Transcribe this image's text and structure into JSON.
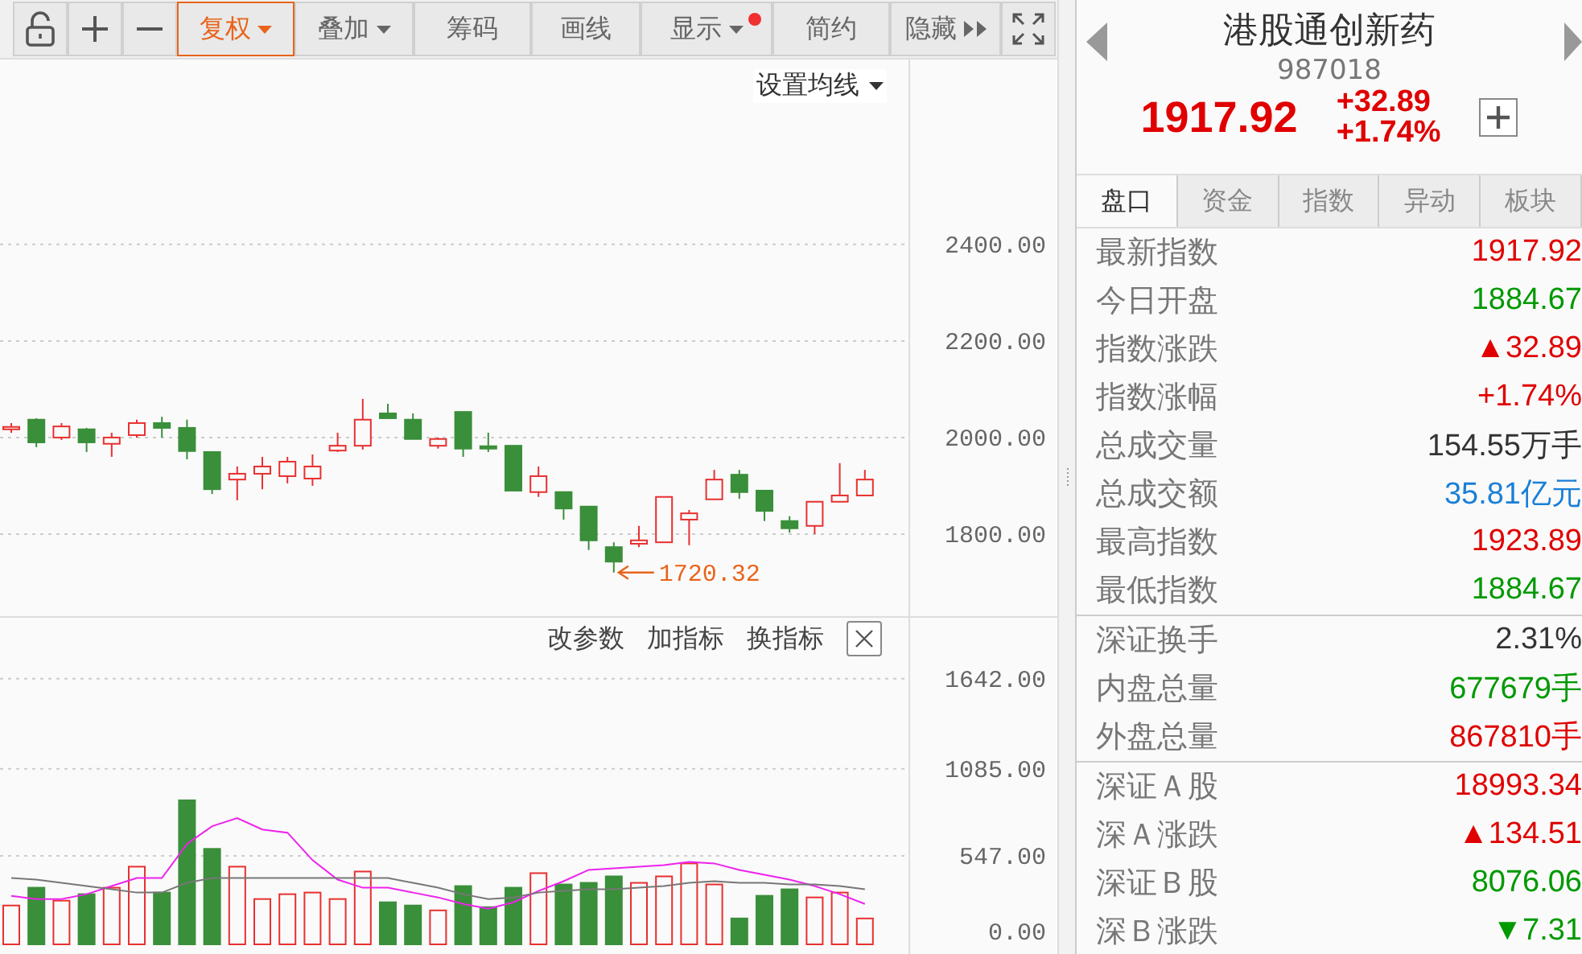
{
  "toolbar": [
    {
      "kind": "lock",
      "selected": false
    },
    {
      "kind": "plus",
      "selected": false
    },
    {
      "kind": "minus",
      "selected": false
    },
    {
      "kind": "text",
      "label": "复权",
      "selected": true,
      "dropdown": true,
      "chevrons": false,
      "alert": false
    },
    {
      "kind": "text",
      "label": "叠加",
      "selected": false,
      "dropdown": true,
      "chevrons": false,
      "alert": false
    },
    {
      "kind": "text",
      "label": "筹码",
      "selected": false,
      "dropdown": false,
      "chevrons": false,
      "alert": false
    },
    {
      "kind": "text",
      "label": "画线",
      "selected": false,
      "dropdown": false,
      "chevrons": false,
      "alert": false
    },
    {
      "kind": "text",
      "label": "显示",
      "selected": false,
      "dropdown": true,
      "chevrons": false,
      "alert": true
    },
    {
      "kind": "text",
      "label": "简约",
      "selected": false,
      "dropdown": false,
      "chevrons": false,
      "alert": false
    },
    {
      "kind": "text",
      "label": "隐藏",
      "selected": false,
      "dropdown": false,
      "chevrons": true,
      "alert": false
    },
    {
      "kind": "fullscreen",
      "selected": false
    }
  ],
  "price_chart": {
    "ma_setting": "设置均线",
    "chart_data": {
      "type": "candlestick",
      "ylim": [
        1630,
        2783
      ],
      "yticks": [
        {
          "value": 2400,
          "label": "2400.00"
        },
        {
          "value": 2200,
          "label": "2200.00"
        },
        {
          "value": 2000,
          "label": "2000.00"
        },
        {
          "value": 1800,
          "label": "1800.00"
        }
      ],
      "ohlc": [
        [
          2018,
          2030,
          2010,
          2022
        ],
        [
          2037,
          2040,
          1980,
          1990
        ],
        [
          2000,
          2030,
          1995,
          2023
        ],
        [
          2017,
          2020,
          1970,
          1990
        ],
        [
          1987,
          2010,
          1960,
          2000
        ],
        [
          2005,
          2037,
          2000,
          2030
        ],
        [
          2030,
          2043,
          2000,
          2020
        ],
        [
          2020,
          2037,
          1955,
          1972
        ],
        [
          1970,
          1970,
          1883,
          1893
        ],
        [
          1913,
          1940,
          1870,
          1925
        ],
        [
          1925,
          1960,
          1893,
          1940
        ],
        [
          1920,
          1960,
          1905,
          1950
        ],
        [
          1915,
          1965,
          1900,
          1940
        ],
        [
          1973,
          2010,
          1970,
          1983
        ],
        [
          1983,
          2080,
          1975,
          2037
        ],
        [
          2050,
          2070,
          2040,
          2040
        ],
        [
          2037,
          2050,
          1997,
          1997
        ],
        [
          1983,
          2000,
          1977,
          1997
        ],
        [
          2053,
          2053,
          1960,
          1977
        ],
        [
          1982,
          2010,
          1970,
          1977
        ],
        [
          1983,
          1983,
          1890,
          1890
        ],
        [
          1887,
          1940,
          1877,
          1920
        ],
        [
          1887,
          1887,
          1830,
          1853
        ],
        [
          1857,
          1857,
          1767,
          1787
        ],
        [
          1773,
          1783,
          1720.32,
          1743
        ],
        [
          1780,
          1817,
          1773,
          1787
        ],
        [
          1783,
          1877,
          1783,
          1877
        ],
        [
          1830,
          1850,
          1777,
          1843
        ],
        [
          1872,
          1933,
          1872,
          1913
        ],
        [
          1923,
          1933,
          1873,
          1887
        ],
        [
          1890,
          1890,
          1827,
          1848
        ],
        [
          1827,
          1837,
          1803,
          1812
        ],
        [
          1817,
          1867,
          1800,
          1867
        ],
        [
          1867,
          1947,
          1867,
          1880
        ],
        [
          1880,
          1933,
          1880,
          1913
        ]
      ],
      "grid": true,
      "annotations": [
        "1720.32"
      ]
    }
  },
  "volume_chart": {
    "actions": [
      "改参数",
      "加指标",
      "换指标"
    ],
    "chart_data": {
      "type": "bar",
      "ylim": [
        0,
        2018
      ],
      "grid": true,
      "stacked": false,
      "yticks": [
        {
          "value": 0,
          "label": "0.00"
        },
        {
          "value": 547,
          "label": "547.00"
        },
        {
          "value": 1085,
          "label": "1085.00"
        },
        {
          "value": 1642,
          "label": "1642.00"
        }
      ],
      "series": [
        {
          "type": "bar",
          "colors": [
            "#e83030",
            "#3a8f3a",
            "#e83030",
            "#3a8f3a",
            "#e83030",
            "#e83030",
            "#3a8f3a",
            "#3a8f3a",
            "#3a8f3a",
            "#e83030",
            "#e83030",
            "#e83030",
            "#e83030",
            "#e83030",
            "#e83030",
            "#3a8f3a",
            "#3a8f3a",
            "#e83030",
            "#3a8f3a",
            "#3a8f3a",
            "#3a8f3a",
            "#e83030",
            "#3a8f3a",
            "#3a8f3a",
            "#3a8f3a",
            "#e83030",
            "#e83030",
            "#e83030",
            "#e83030",
            "#3a8f3a",
            "#3a8f3a",
            "#3a8f3a",
            "#e83030",
            "#e83030",
            "#e83030"
          ],
          "values": [
            240,
            350,
            270,
            310,
            350,
            480,
            320,
            890,
            590,
            480,
            280,
            310,
            320,
            280,
            450,
            260,
            240,
            210,
            360,
            230,
            350,
            440,
            370,
            380,
            420,
            380,
            420,
            500,
            370,
            160,
            300,
            340,
            290,
            320,
            160
          ]
        },
        {
          "type": "line",
          "color": "#ee22ee",
          "values": [
            300,
            280,
            280,
            310,
            360,
            410,
            410,
            620,
            730,
            780,
            710,
            690,
            520,
            400,
            350,
            350,
            320,
            290,
            250,
            220,
            260,
            330,
            390,
            460,
            470,
            480,
            490,
            510,
            500,
            460,
            430,
            400,
            360,
            310,
            250
          ]
        },
        {
          "type": "line",
          "color": "#777777",
          "values": [
            410,
            400,
            380,
            360,
            340,
            320,
            320,
            380,
            410,
            410,
            410,
            410,
            410,
            410,
            410,
            410,
            380,
            350,
            310,
            280,
            290,
            320,
            330,
            340,
            340,
            350,
            360,
            380,
            390,
            380,
            380,
            370,
            370,
            360,
            340
          ]
        }
      ]
    }
  },
  "quote": {
    "name": "港股通创新药",
    "code": "987018",
    "price": "1917.92",
    "change": "+32.89",
    "change_pct": "+1.74%"
  },
  "tabs": [
    {
      "label": "盘口",
      "selected": true
    },
    {
      "label": "资金",
      "selected": false
    },
    {
      "label": "指数",
      "selected": false
    },
    {
      "label": "异动",
      "selected": false
    },
    {
      "label": "板块",
      "selected": false
    }
  ],
  "stat_groups": [
    [
      {
        "label": "最新指数",
        "value": "1917.92",
        "color": "#e00000"
      },
      {
        "label": "今日开盘",
        "value": "1884.67",
        "color": "#009900"
      },
      {
        "label": "指数涨跌",
        "value": "▲32.89",
        "color": "#e00000"
      },
      {
        "label": "指数涨幅",
        "value": "+1.74%",
        "color": "#e00000"
      },
      {
        "label": "总成交量",
        "value": "154.55万手",
        "color": "#333333"
      },
      {
        "label": "总成交额",
        "value": "35.81亿元",
        "color": "#1a7fd6"
      },
      {
        "label": "最高指数",
        "value": "1923.89",
        "color": "#e00000"
      },
      {
        "label": "最低指数",
        "value": "1884.67",
        "color": "#009900"
      }
    ],
    [
      {
        "label": "深证换手",
        "value": "2.31%",
        "color": "#333333"
      },
      {
        "label": "内盘总量",
        "value": "677679手",
        "color": "#009900"
      },
      {
        "label": "外盘总量",
        "value": "867810手",
        "color": "#e00000"
      }
    ],
    [
      {
        "label": "深证Ａ股",
        "value": "18993.34",
        "color": "#e00000"
      },
      {
        "label": "深Ａ涨跌",
        "value": "▲134.51",
        "color": "#e00000"
      },
      {
        "label": "深证Ｂ股",
        "value": "8076.06",
        "color": "#009900"
      },
      {
        "label": "深Ｂ涨跌",
        "value": "▼7.31",
        "color": "#009900"
      }
    ]
  ]
}
